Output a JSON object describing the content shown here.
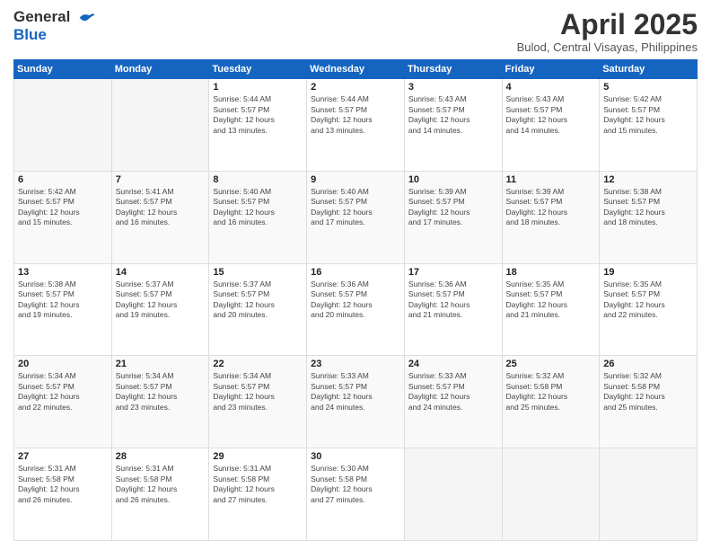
{
  "logo": {
    "line1": "General",
    "line2": "Blue"
  },
  "title": "April 2025",
  "location": "Bulod, Central Visayas, Philippines",
  "days_header": [
    "Sunday",
    "Monday",
    "Tuesday",
    "Wednesday",
    "Thursday",
    "Friday",
    "Saturday"
  ],
  "weeks": [
    [
      {
        "num": "",
        "info": ""
      },
      {
        "num": "",
        "info": ""
      },
      {
        "num": "1",
        "info": "Sunrise: 5:44 AM\nSunset: 5:57 PM\nDaylight: 12 hours\nand 13 minutes."
      },
      {
        "num": "2",
        "info": "Sunrise: 5:44 AM\nSunset: 5:57 PM\nDaylight: 12 hours\nand 13 minutes."
      },
      {
        "num": "3",
        "info": "Sunrise: 5:43 AM\nSunset: 5:57 PM\nDaylight: 12 hours\nand 14 minutes."
      },
      {
        "num": "4",
        "info": "Sunrise: 5:43 AM\nSunset: 5:57 PM\nDaylight: 12 hours\nand 14 minutes."
      },
      {
        "num": "5",
        "info": "Sunrise: 5:42 AM\nSunset: 5:57 PM\nDaylight: 12 hours\nand 15 minutes."
      }
    ],
    [
      {
        "num": "6",
        "info": "Sunrise: 5:42 AM\nSunset: 5:57 PM\nDaylight: 12 hours\nand 15 minutes."
      },
      {
        "num": "7",
        "info": "Sunrise: 5:41 AM\nSunset: 5:57 PM\nDaylight: 12 hours\nand 16 minutes."
      },
      {
        "num": "8",
        "info": "Sunrise: 5:40 AM\nSunset: 5:57 PM\nDaylight: 12 hours\nand 16 minutes."
      },
      {
        "num": "9",
        "info": "Sunrise: 5:40 AM\nSunset: 5:57 PM\nDaylight: 12 hours\nand 17 minutes."
      },
      {
        "num": "10",
        "info": "Sunrise: 5:39 AM\nSunset: 5:57 PM\nDaylight: 12 hours\nand 17 minutes."
      },
      {
        "num": "11",
        "info": "Sunrise: 5:39 AM\nSunset: 5:57 PM\nDaylight: 12 hours\nand 18 minutes."
      },
      {
        "num": "12",
        "info": "Sunrise: 5:38 AM\nSunset: 5:57 PM\nDaylight: 12 hours\nand 18 minutes."
      }
    ],
    [
      {
        "num": "13",
        "info": "Sunrise: 5:38 AM\nSunset: 5:57 PM\nDaylight: 12 hours\nand 19 minutes."
      },
      {
        "num": "14",
        "info": "Sunrise: 5:37 AM\nSunset: 5:57 PM\nDaylight: 12 hours\nand 19 minutes."
      },
      {
        "num": "15",
        "info": "Sunrise: 5:37 AM\nSunset: 5:57 PM\nDaylight: 12 hours\nand 20 minutes."
      },
      {
        "num": "16",
        "info": "Sunrise: 5:36 AM\nSunset: 5:57 PM\nDaylight: 12 hours\nand 20 minutes."
      },
      {
        "num": "17",
        "info": "Sunrise: 5:36 AM\nSunset: 5:57 PM\nDaylight: 12 hours\nand 21 minutes."
      },
      {
        "num": "18",
        "info": "Sunrise: 5:35 AM\nSunset: 5:57 PM\nDaylight: 12 hours\nand 21 minutes."
      },
      {
        "num": "19",
        "info": "Sunrise: 5:35 AM\nSunset: 5:57 PM\nDaylight: 12 hours\nand 22 minutes."
      }
    ],
    [
      {
        "num": "20",
        "info": "Sunrise: 5:34 AM\nSunset: 5:57 PM\nDaylight: 12 hours\nand 22 minutes."
      },
      {
        "num": "21",
        "info": "Sunrise: 5:34 AM\nSunset: 5:57 PM\nDaylight: 12 hours\nand 23 minutes."
      },
      {
        "num": "22",
        "info": "Sunrise: 5:34 AM\nSunset: 5:57 PM\nDaylight: 12 hours\nand 23 minutes."
      },
      {
        "num": "23",
        "info": "Sunrise: 5:33 AM\nSunset: 5:57 PM\nDaylight: 12 hours\nand 24 minutes."
      },
      {
        "num": "24",
        "info": "Sunrise: 5:33 AM\nSunset: 5:57 PM\nDaylight: 12 hours\nand 24 minutes."
      },
      {
        "num": "25",
        "info": "Sunrise: 5:32 AM\nSunset: 5:58 PM\nDaylight: 12 hours\nand 25 minutes."
      },
      {
        "num": "26",
        "info": "Sunrise: 5:32 AM\nSunset: 5:58 PM\nDaylight: 12 hours\nand 25 minutes."
      }
    ],
    [
      {
        "num": "27",
        "info": "Sunrise: 5:31 AM\nSunset: 5:58 PM\nDaylight: 12 hours\nand 26 minutes."
      },
      {
        "num": "28",
        "info": "Sunrise: 5:31 AM\nSunset: 5:58 PM\nDaylight: 12 hours\nand 26 minutes."
      },
      {
        "num": "29",
        "info": "Sunrise: 5:31 AM\nSunset: 5:58 PM\nDaylight: 12 hours\nand 27 minutes."
      },
      {
        "num": "30",
        "info": "Sunrise: 5:30 AM\nSunset: 5:58 PM\nDaylight: 12 hours\nand 27 minutes."
      },
      {
        "num": "",
        "info": ""
      },
      {
        "num": "",
        "info": ""
      },
      {
        "num": "",
        "info": ""
      }
    ]
  ]
}
